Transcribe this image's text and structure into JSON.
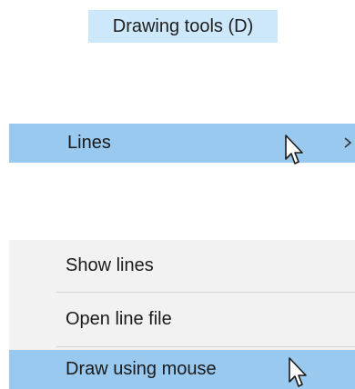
{
  "title_button": {
    "label": "Drawing tools (D)"
  },
  "lines_item": {
    "label": "Lines",
    "submenu_indicator": "chevron-right-icon"
  },
  "menu": {
    "items": [
      {
        "label": "Show lines"
      },
      {
        "label": "Open line file"
      },
      {
        "label": "Draw using mouse"
      }
    ]
  },
  "colors": {
    "title_highlight": "#cde8fb",
    "item_highlight": "#99c9ef",
    "menu_background": "#f2f2f2",
    "separator": "#d4d4d4"
  }
}
